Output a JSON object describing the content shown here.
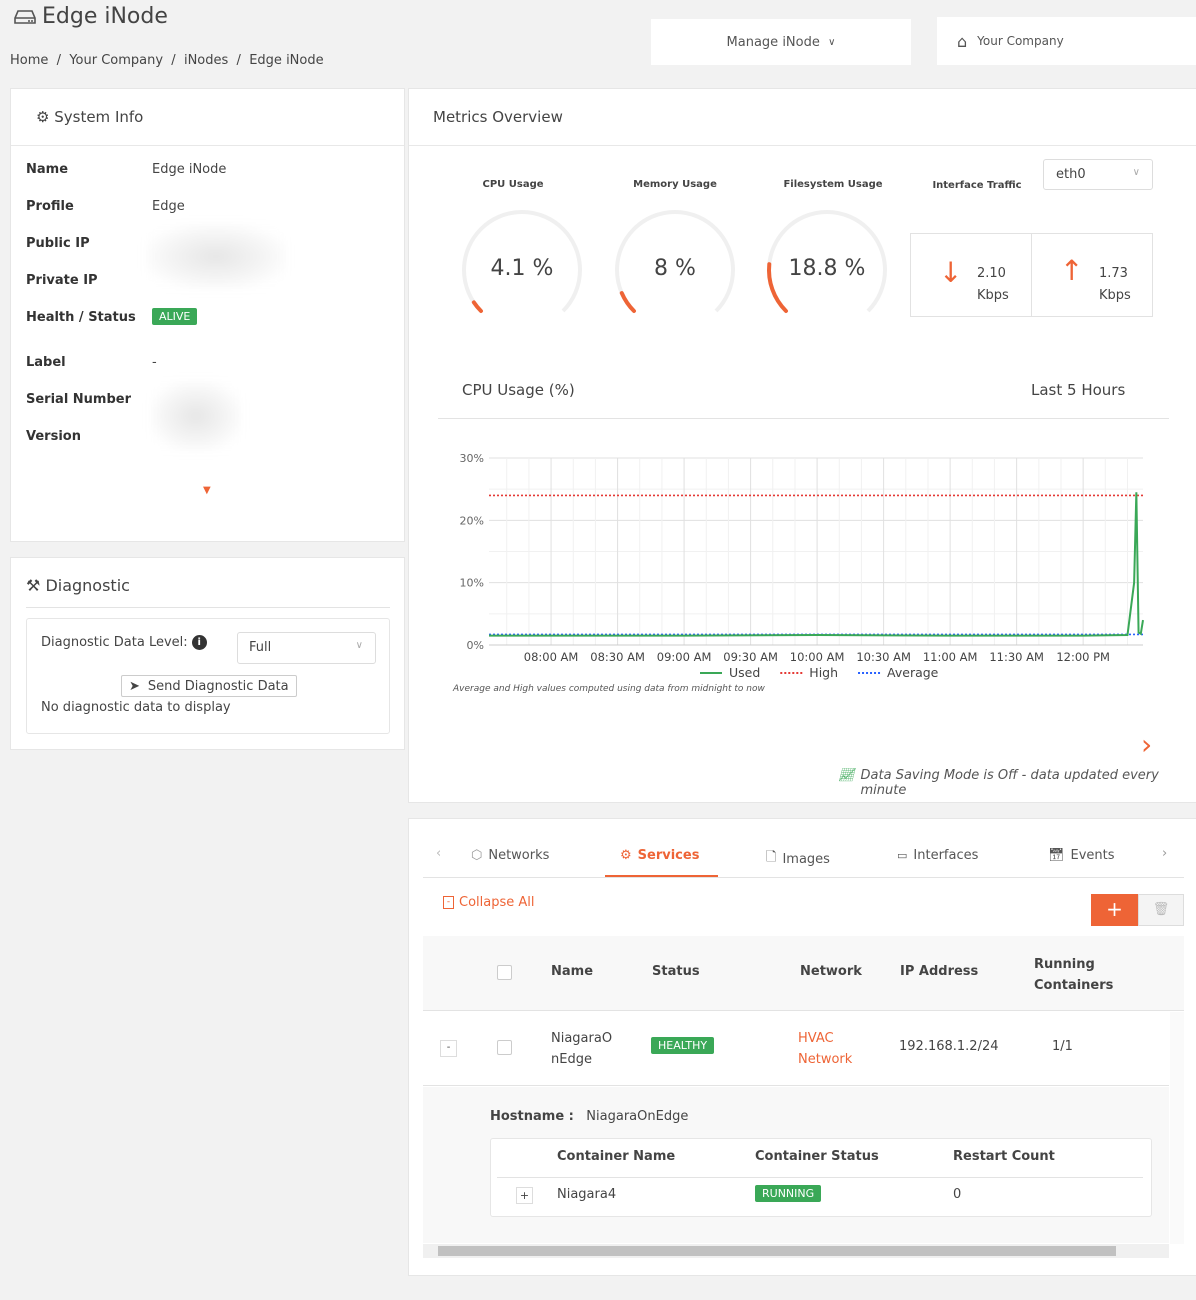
{
  "header": {
    "title": "Edge iNode",
    "breadcrumb": [
      "Home",
      "Your Company",
      "iNodes",
      "Edge iNode"
    ],
    "manage_label": "Manage iNode",
    "company_label": "Your Company"
  },
  "system_info": {
    "title": "System Info",
    "fields": [
      {
        "label": "Name",
        "value": "Edge iNode"
      },
      {
        "label": "Profile",
        "value": "Edge"
      },
      {
        "label": "Public IP",
        "value": ""
      },
      {
        "label": "Private IP",
        "value": ""
      },
      {
        "label": "Health / Status",
        "value": "ALIVE"
      },
      {
        "label": "Label",
        "value": "-"
      },
      {
        "label": "Serial Number",
        "value": ""
      },
      {
        "label": "Version",
        "value": ""
      }
    ]
  },
  "diagnostic": {
    "title": "Diagnostic",
    "level_label": "Diagnostic Data Level:",
    "level_value": "Full",
    "send_label": "Send Diagnostic Data",
    "empty_text": "No diagnostic data to display"
  },
  "metrics": {
    "title": "Metrics Overview",
    "gauges": [
      {
        "label": "CPU Usage",
        "value": 4.1,
        "text": "4.1 %"
      },
      {
        "label": "Memory Usage",
        "value": 8,
        "text": "8 %"
      },
      {
        "label": "Filesystem Usage",
        "value": 18.8,
        "text": "18.8 %"
      }
    ],
    "traffic_label": "Interface Traffic",
    "interface": "eth0",
    "download": {
      "value": "2.10",
      "unit": "Kbps"
    },
    "upload": {
      "value": "1.73",
      "unit": "Kbps"
    },
    "chart_title": "CPU Usage (%)",
    "range_label": "Last 5 Hours",
    "note": "Average and High values computed using data from midnight to now",
    "data_saving": "Data Saving Mode is Off - data updated every minute"
  },
  "chart_data": {
    "type": "line",
    "xlim": [
      "07:32",
      "12:27"
    ],
    "ylim": [
      0,
      30
    ],
    "grid": true,
    "legend": "bottom",
    "yticks": [
      "0%",
      "10%",
      "20%",
      "30%"
    ],
    "xticks": [
      "08:00 AM",
      "08:30 AM",
      "09:00 AM",
      "09:30 AM",
      "10:00 AM",
      "10:30 AM",
      "11:00 AM",
      "11:30 AM",
      "12:00 PM"
    ],
    "series": [
      {
        "name": "Used",
        "color": "#3aa857",
        "style": "solid",
        "x": [
          "07:32",
          "08:00",
          "09:00",
          "10:00",
          "11:00",
          "12:00",
          "12:20",
          "12:23",
          "12:24",
          "12:25",
          "12:26",
          "12:27"
        ],
        "y": [
          1.5,
          1.5,
          1.5,
          1.6,
          1.5,
          1.5,
          1.6,
          10,
          24.5,
          2,
          1.8,
          4
        ]
      },
      {
        "name": "High",
        "color": "#e53935",
        "style": "dotted",
        "x": [
          "07:32",
          "12:27"
        ],
        "y": [
          24,
          24
        ]
      },
      {
        "name": "Average",
        "color": "#2962ff",
        "style": "dotted",
        "x": [
          "07:32",
          "12:27"
        ],
        "y": [
          1.7,
          1.7
        ]
      }
    ]
  },
  "tabs": [
    {
      "label": "Networks"
    },
    {
      "label": "Services",
      "active": true
    },
    {
      "label": "Images"
    },
    {
      "label": "Interfaces"
    },
    {
      "label": "Events"
    }
  ],
  "services": {
    "collapse_label": "Collapse All",
    "add_label": "+",
    "columns": [
      "Name",
      "Status",
      "Network",
      "IP Address",
      "Running Containers"
    ],
    "rows": [
      {
        "name": "NiagaraOnEdge",
        "name_l1": "NiagaraO",
        "name_l2": "nEdge",
        "status": "HEALTHY",
        "network_l1": "HVAC",
        "network_l2": "Network",
        "ip": "192.168.1.2/24",
        "running": "1/1",
        "hostname_label": "Hostname :",
        "hostname": "NiagaraOnEdge",
        "containers": {
          "columns": [
            "Container Name",
            "Container Status",
            "Restart Count"
          ],
          "rows": [
            {
              "name": "Niagara4",
              "status": "RUNNING",
              "restarts": "0"
            }
          ]
        }
      }
    ]
  },
  "colors": {
    "accent": "#ee6436",
    "success": "#3aa857"
  }
}
